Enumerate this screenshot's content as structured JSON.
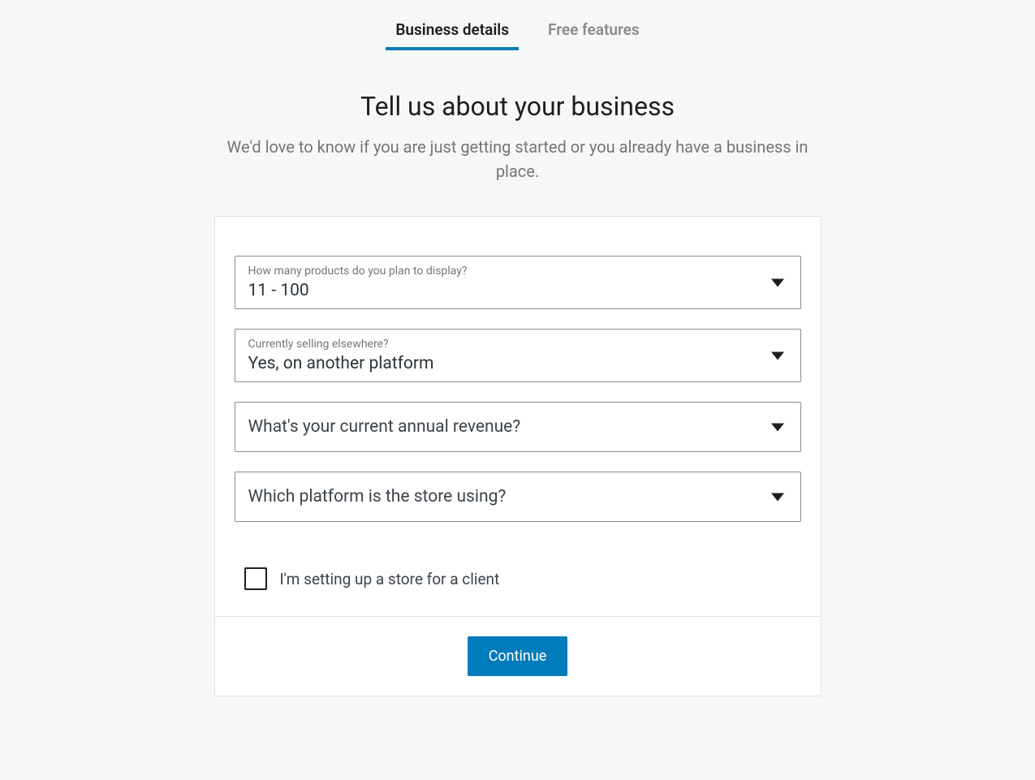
{
  "tabs": {
    "active": "Business details",
    "inactive": "Free features"
  },
  "header": {
    "title": "Tell us about your business",
    "subtitle": "We'd love to know if you are just getting started or you already have a business in place."
  },
  "form": {
    "products": {
      "label": "How many products do you plan to display?",
      "value": "11 - 100"
    },
    "selling": {
      "label": "Currently selling elsewhere?",
      "value": "Yes, on another platform"
    },
    "revenue": {
      "placeholder": "What's your current annual revenue?"
    },
    "platform": {
      "placeholder": "Which platform is the store using?"
    },
    "client_checkbox": {
      "label": "I'm setting up a store for a client",
      "checked": false
    }
  },
  "footer": {
    "continue_label": "Continue"
  }
}
